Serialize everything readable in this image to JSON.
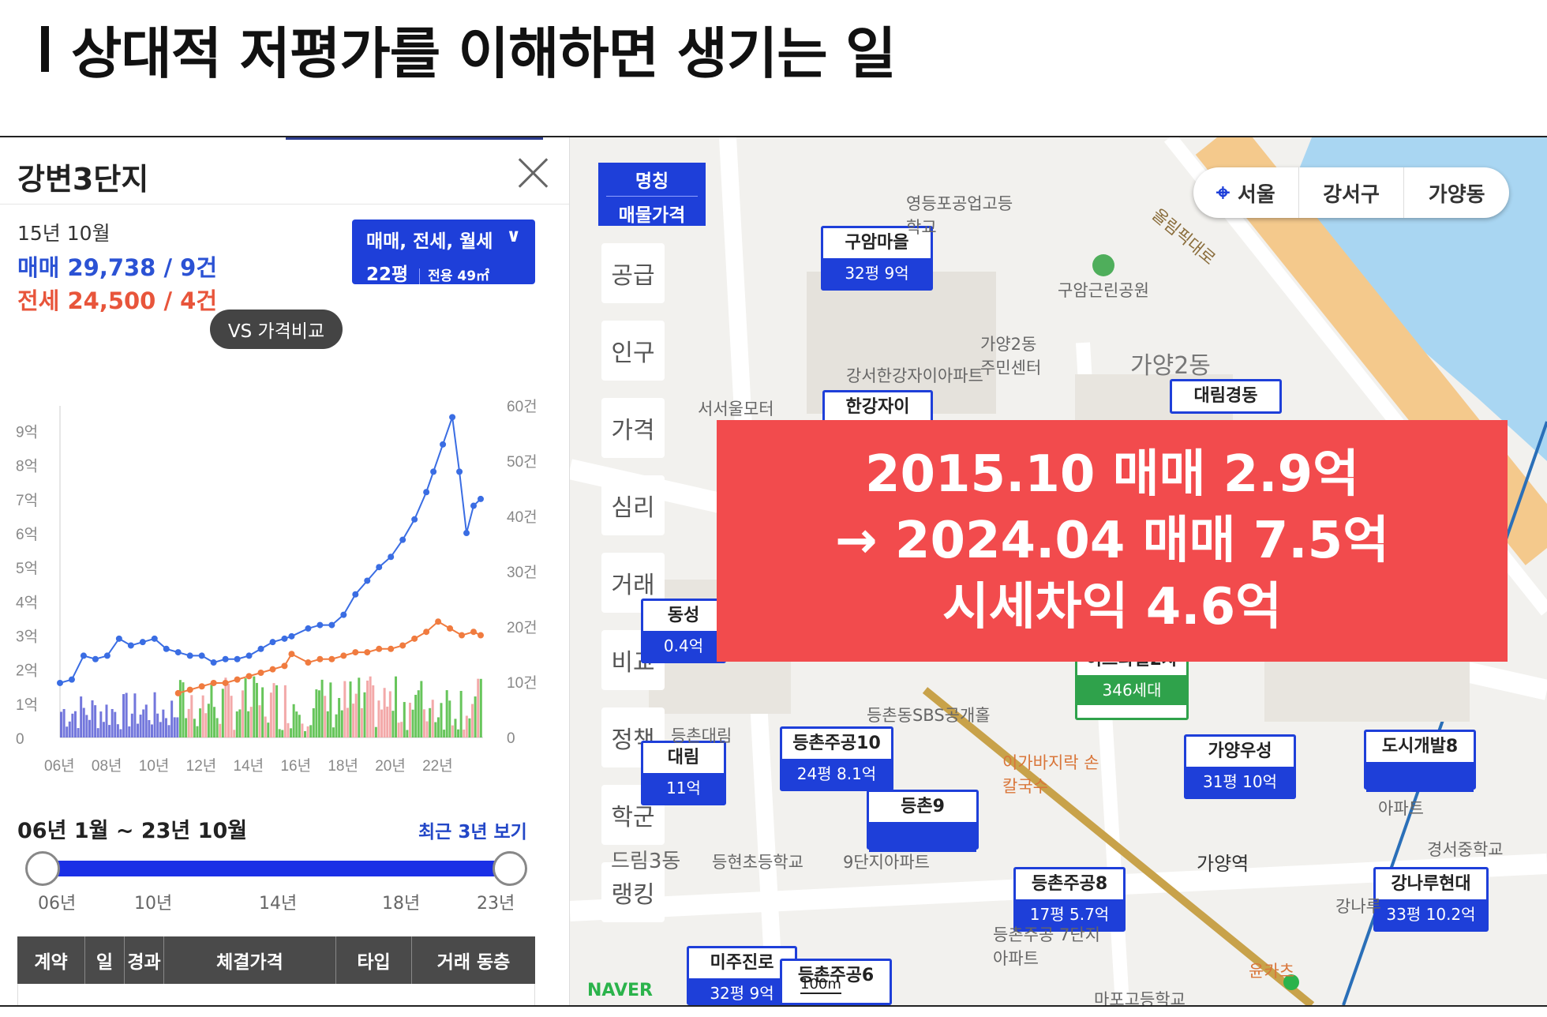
{
  "slide": {
    "title": "상대적 저평가를 이해하면 생기는 일"
  },
  "panel": {
    "complex_name": "강변3단지",
    "date": "15년 10월",
    "sale": "매매 29,738 / 9건",
    "jeonse": "전세 24,500 / 4건",
    "filter_line1": "매매, 전세, 월세",
    "filter_size": "22평",
    "filter_area": "전용 49㎡",
    "vs_button": "VS 가격비교",
    "range_label": "06년 1월 ~ 23년 10월",
    "recent_link": "최근 3년 보기",
    "slider_ticks": [
      "06년",
      "10년",
      "14년",
      "18년",
      "23년"
    ],
    "table_headers": [
      "계약",
      "일",
      "경과",
      "체결가격",
      "타입",
      "거래 동층"
    ]
  },
  "chart_data": {
    "type": "line",
    "x_ticks": [
      "06년",
      "08년",
      "10년",
      "12년",
      "14년",
      "16년",
      "18년",
      "20년",
      "22년"
    ],
    "y_left_ticks": [
      "0",
      "1억",
      "2억",
      "3억",
      "4억",
      "5억",
      "6억",
      "7억",
      "8억",
      "9억"
    ],
    "y_right_ticks": [
      "0",
      "10건",
      "20건",
      "30건",
      "40건",
      "50건",
      "60건"
    ],
    "ylim_left": [
      0,
      9.5
    ],
    "ylim_right": [
      0,
      60
    ],
    "colors": {
      "sale": "#3a6de3",
      "jeonse": "#f07b3f",
      "volume_sale": "#5a5fd6",
      "volume_red": "#f19a9a",
      "volume_green": "#4cbb3e"
    },
    "series": [
      {
        "name": "매매",
        "x": [
          2006.0,
          2006.5,
          2007.0,
          2007.5,
          2008.0,
          2008.5,
          2009.0,
          2009.5,
          2010.0,
          2010.5,
          2011.0,
          2011.5,
          2012.0,
          2012.5,
          2013.0,
          2013.5,
          2014.0,
          2014.5,
          2015.0,
          2015.5,
          2015.8,
          2016.5,
          2017.0,
          2017.5,
          2018.0,
          2018.5,
          2019.0,
          2019.5,
          2020.0,
          2020.5,
          2021.0,
          2021.5,
          2021.8,
          2022.2,
          2022.6,
          2022.9,
          2023.2,
          2023.5,
          2023.8
        ],
        "values": [
          1.6,
          1.7,
          2.4,
          2.3,
          2.4,
          2.9,
          2.7,
          2.8,
          2.9,
          2.6,
          2.5,
          2.4,
          2.4,
          2.2,
          2.3,
          2.3,
          2.4,
          2.6,
          2.8,
          2.9,
          2.97,
          3.2,
          3.3,
          3.3,
          3.6,
          4.2,
          4.6,
          5.0,
          5.3,
          5.8,
          6.4,
          7.2,
          7.8,
          8.6,
          9.4,
          7.8,
          6.0,
          6.8,
          7.0
        ]
      },
      {
        "name": "전세",
        "x": [
          2011.0,
          2011.5,
          2012.0,
          2012.5,
          2013.0,
          2013.5,
          2014.0,
          2014.5,
          2015.0,
          2015.5,
          2015.8,
          2016.5,
          2017.0,
          2017.5,
          2018.0,
          2018.5,
          2019.0,
          2019.5,
          2020.0,
          2020.5,
          2021.0,
          2021.5,
          2022.0,
          2022.5,
          2023.0,
          2023.5,
          2023.8
        ],
        "values": [
          1.3,
          1.4,
          1.5,
          1.6,
          1.6,
          1.7,
          1.8,
          1.9,
          2.0,
          2.1,
          2.45,
          2.2,
          2.3,
          2.3,
          2.4,
          2.5,
          2.5,
          2.6,
          2.6,
          2.7,
          2.9,
          3.1,
          3.4,
          3.2,
          3.0,
          3.1,
          3.0
        ]
      }
    ]
  },
  "map": {
    "location": [
      "서울",
      "강서구",
      "가양동"
    ],
    "marker_toggle": [
      "명칭",
      "매물가격"
    ],
    "side_tabs": [
      "공급",
      "인구",
      "가격",
      "심리",
      "거래",
      "비교",
      "정책",
      "학군",
      "랭킹"
    ],
    "markers": [
      {
        "name": "구암마을",
        "price": "32평 9억"
      },
      {
        "name": "한강자이",
        "price": ""
      },
      {
        "name": "대림경동",
        "price": ""
      },
      {
        "name": "등촌주공10",
        "price": "24평 8.1억"
      },
      {
        "name": "등촌9",
        "price": ""
      },
      {
        "name": "가양우성",
        "price": "31평 10억"
      },
      {
        "name": "도시개발8",
        "price": ""
      },
      {
        "name": "등촌주공8",
        "price": "17평 5.7억"
      },
      {
        "name": "강나루현대",
        "price": "33평 10.2억"
      },
      {
        "name": "미주진로",
        "price": "32평 9억"
      },
      {
        "name": "등촌주공6",
        "price": ""
      },
      {
        "name": "이스타빌2차",
        "price": "346세대"
      },
      {
        "name": "대림",
        "price": "11억"
      },
      {
        "name": "동성",
        "price": "0.4억"
      }
    ],
    "labels": [
      "영등포공업고등학교",
      "구암근린공원",
      "가양2동 주민센터",
      "가양2동",
      "강서한강자이아파트",
      "서서울모터",
      "등촌동SBS공개홀",
      "이가바지락 손칼국수",
      "등촌대림",
      "등현초등학교",
      "9단지아파트",
      "가양역",
      "등촌주공 7단지아파트",
      "경서중학교",
      "아파트",
      "윤카츠",
      "마포고등학교",
      "강나루",
      "올림픽대로",
      "드림3동"
    ],
    "naver": "NAVER",
    "scale": "100m"
  },
  "overlay": {
    "line1": "2015.10 매매 2.9억",
    "line2": "→ 2024.04 매매 7.5억",
    "line3": "시세차익 4.6억"
  }
}
